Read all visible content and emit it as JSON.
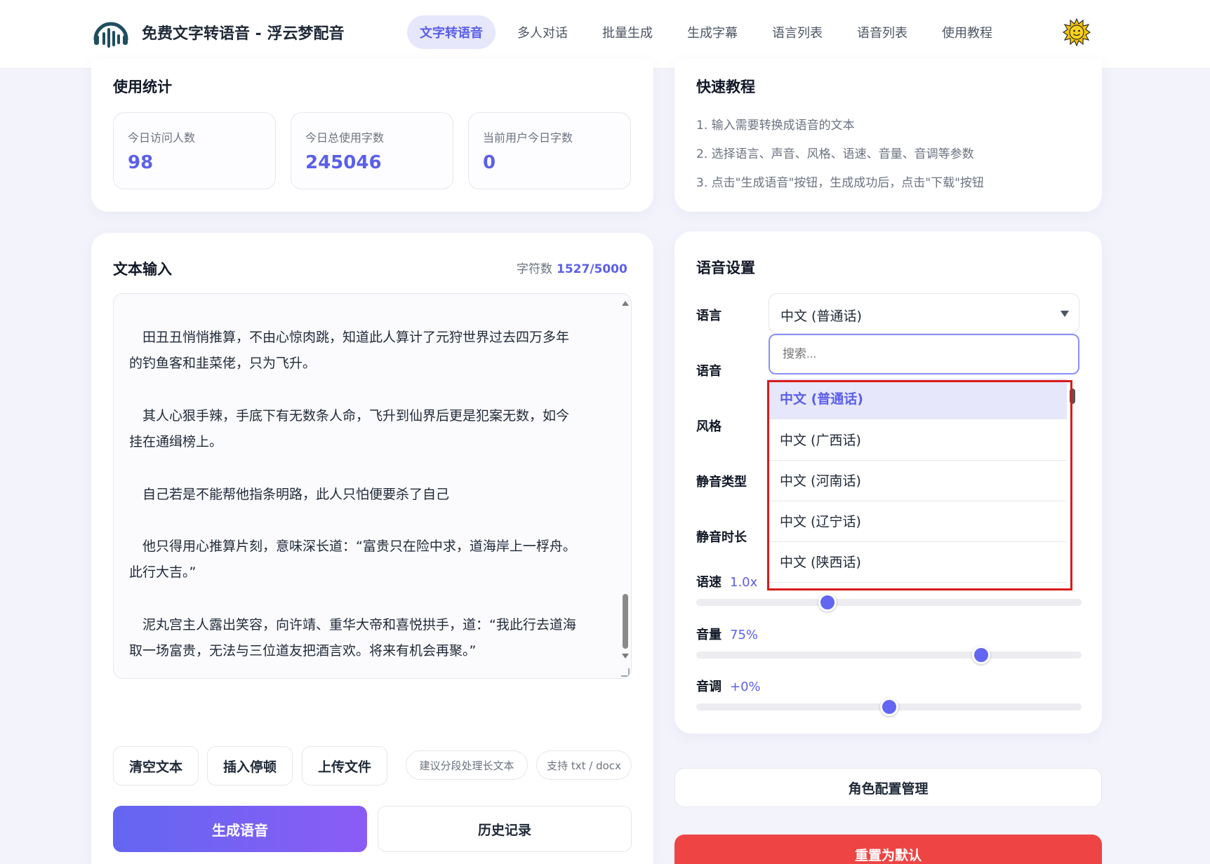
{
  "header": {
    "app_title": "免费文字转语音 - 浮云梦配音",
    "nav": [
      "文字转语音",
      "多人对话",
      "批量生成",
      "生成字幕",
      "语言列表",
      "语音列表",
      "使用教程"
    ],
    "active_nav": "文字转语音",
    "logo_icon": "soundwave-logo-icon",
    "theme_icon": "sun-icon"
  },
  "stats": {
    "title": "使用统计",
    "items": [
      {
        "label": "今日访问人数",
        "value": "98"
      },
      {
        "label": "今日总使用字数",
        "value": "245046"
      },
      {
        "label": "当前用户今日字数",
        "value": "0"
      }
    ]
  },
  "tutorial": {
    "title": "快速教程",
    "steps": [
      "1. 输入需要转换成语音的文本",
      "2. 选择语言、声音、风格、语速、音量、音调等参数",
      "3. 点击\"生成语音\"按钮，生成成功后，点击\"下载\"按钮"
    ]
  },
  "text_input": {
    "title": "文本输入",
    "char_count_label": "字符数",
    "char_count": "1527/5000",
    "paragraphs": [
      [
        "　田丑丑悄悄推算，不由心惊肉跳，知道此人算计了元狩世界过去四万多年",
        "的钓鱼客和韭菜佬，只为飞升。"
      ],
      [
        "　其人心狠手辣，手底下有无数条人命，飞升到仙界后更是犯案无数，如今",
        "挂在通缉榜上。"
      ],
      [
        "　自己若是不能帮他指条明路，此人只怕便要杀了自己"
      ],
      [
        "　他只得用心推算片刻，意味深长道：“富贵只在险中求，道海岸上一桴舟。",
        "此行大吉。”"
      ],
      [
        "　泥丸宫主人露出笑容，向许靖、重华大帝和喜悦拱手，道：“我此行去道海",
        "取一场富贵，无法与三位道友把酒言欢。将来有机会再聚。”"
      ]
    ],
    "buttons": {
      "clear": "清空文本",
      "pause": "插入停顿",
      "upload": "上传文件"
    },
    "hints": [
      "建议分段处理长文本",
      "支持 txt / docx"
    ],
    "generate": "生成语音",
    "history": "历史记录"
  },
  "voice_settings": {
    "title": "语音设置",
    "labels": {
      "language": "语言",
      "voice": "语音",
      "style": "风格",
      "silence_type": "静音类型",
      "silence_duration": "静音时长"
    },
    "language_selected": "中文 (普通话)",
    "search_placeholder": "搜索...",
    "language_options": [
      "中文 (普通话)",
      "中文 (广西话)",
      "中文 (河南话)",
      "中文 (辽宁话)",
      "中文 (陕西话)"
    ],
    "rate": {
      "label": "语速",
      "value": "1.0x",
      "fraction": 0.34
    },
    "volume": {
      "label": "音量",
      "value": "75%",
      "fraction": 0.74
    },
    "pitch": {
      "label": "音调",
      "value": "+0%",
      "fraction": 0.5
    }
  },
  "role_config": "角色配置管理",
  "reset": "重置为默认",
  "colors": {
    "accent": "#5b5fe8",
    "danger": "#ef4444",
    "highlight": "#d81b1b"
  }
}
